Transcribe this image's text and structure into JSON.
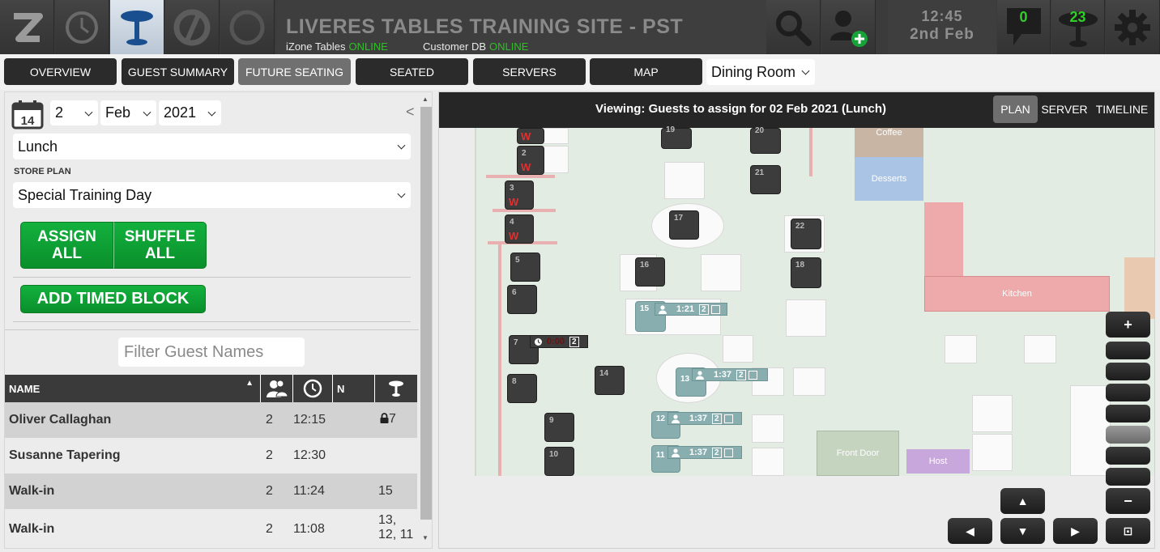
{
  "header": {
    "title": "LIVERES TABLES TRAINING SITE - PST",
    "izone_label": "iZone Tables",
    "izone_status": "ONLINE",
    "customer_db_label": "Customer DB",
    "customer_db_status": "ONLINE",
    "time": "12:45",
    "date": "2nd Feb",
    "messages_count": "0",
    "tables_count": "23",
    "icons": [
      "izone-logo-icon",
      "clock-icon",
      "table-icon",
      "slash-circle-icon",
      "ring-icon",
      "search-icon",
      "add-user-icon",
      "message-bubble-icon",
      "table-count-icon",
      "gear-icon"
    ]
  },
  "nav": {
    "tabs": [
      {
        "label": "OVERVIEW",
        "selected": false
      },
      {
        "label": "GUEST SUMMARY",
        "selected": false
      },
      {
        "label": "FUTURE SEATING",
        "selected": true
      },
      {
        "label": "SEATED",
        "selected": false
      },
      {
        "label": "SERVERS",
        "selected": false
      },
      {
        "label": "MAP",
        "selected": false
      }
    ],
    "room_select": "Dining Room"
  },
  "left": {
    "calendar_icon_text": "14",
    "day": "2",
    "month": "Feb",
    "year": "2021",
    "collapse_glyph": "<",
    "service": "Lunch",
    "store_plan_label": "STORE PLAN",
    "store_plan": "Special Training Day",
    "assign_all_line1": "ASSIGN",
    "assign_all_line2": "ALL",
    "shuffle_all_line1": "SHUFFLE",
    "shuffle_all_line2": "ALL",
    "add_timed_block": "ADD TIMED BLOCK",
    "filter_placeholder": "Filter Guest Names",
    "columns": {
      "name": "NAME",
      "n": "N",
      "sort_glyph": "▲"
    },
    "rows": [
      {
        "name": "Oliver Callaghan",
        "covers": "2",
        "time": "12:15",
        "table": "7",
        "locked": true
      },
      {
        "name": "Susanne Tapering",
        "covers": "2",
        "time": "12:30",
        "table": "",
        "locked": false
      },
      {
        "name": "Walk-in",
        "covers": "2",
        "time": "11:24",
        "table": "15",
        "locked": false
      },
      {
        "name": "Walk-in",
        "covers": "2",
        "time": "11:08",
        "table": "13,\n12, 11",
        "locked": false
      }
    ]
  },
  "map": {
    "viewing_text": "Viewing: Guests to assign for 02 Feb 2021 (Lunch)",
    "view_tabs": [
      {
        "label": "PLAN",
        "selected": true
      },
      {
        "label": "SERVER",
        "selected": false
      },
      {
        "label": "TIMELINE",
        "selected": false
      }
    ],
    "zones": {
      "coffee": "Coffee",
      "desserts": "Desserts",
      "kitchen": "Kitchen",
      "front_door": "Front Door",
      "host": "Host"
    },
    "tables": {
      "t1": "",
      "t2": "2",
      "t3": "3",
      "t4": "4",
      "t5": "5",
      "t6": "6",
      "t7": "7",
      "t8": "8",
      "t9": "9",
      "t10": "10",
      "t11": "11",
      "t12": "12",
      "t13": "13",
      "t14": "14",
      "t15": "15",
      "t16": "16",
      "t17": "17",
      "t18": "18",
      "t19": "19",
      "t20": "20",
      "t21": "21",
      "t22": "22"
    },
    "walkin_marker": "W",
    "overlays": {
      "t7_time": "0:00",
      "t7_count": "2",
      "t15_time": "1:21",
      "t15_count": "2",
      "t13_time": "1:37",
      "t13_count": "2",
      "t12_time": "1:37",
      "t12_count": "2",
      "t11_time": "1:37",
      "t11_count": "2"
    },
    "controls": {
      "zoom_in": "+",
      "zoom_out": "−",
      "pan_up": "▲",
      "pan_down": "▼",
      "pan_left": "◀",
      "pan_right": "▶",
      "fit": "⊡"
    }
  },
  "colors": {
    "accent_green": "#2ec026",
    "button_green": "#0f9e35",
    "walkin_red": "#e03030",
    "assigned_teal": "#89aeb0",
    "kitchen_pink": "#eeaaaa",
    "desserts_blue": "#a9c4e4",
    "host_purple": "#c8a8dc"
  }
}
